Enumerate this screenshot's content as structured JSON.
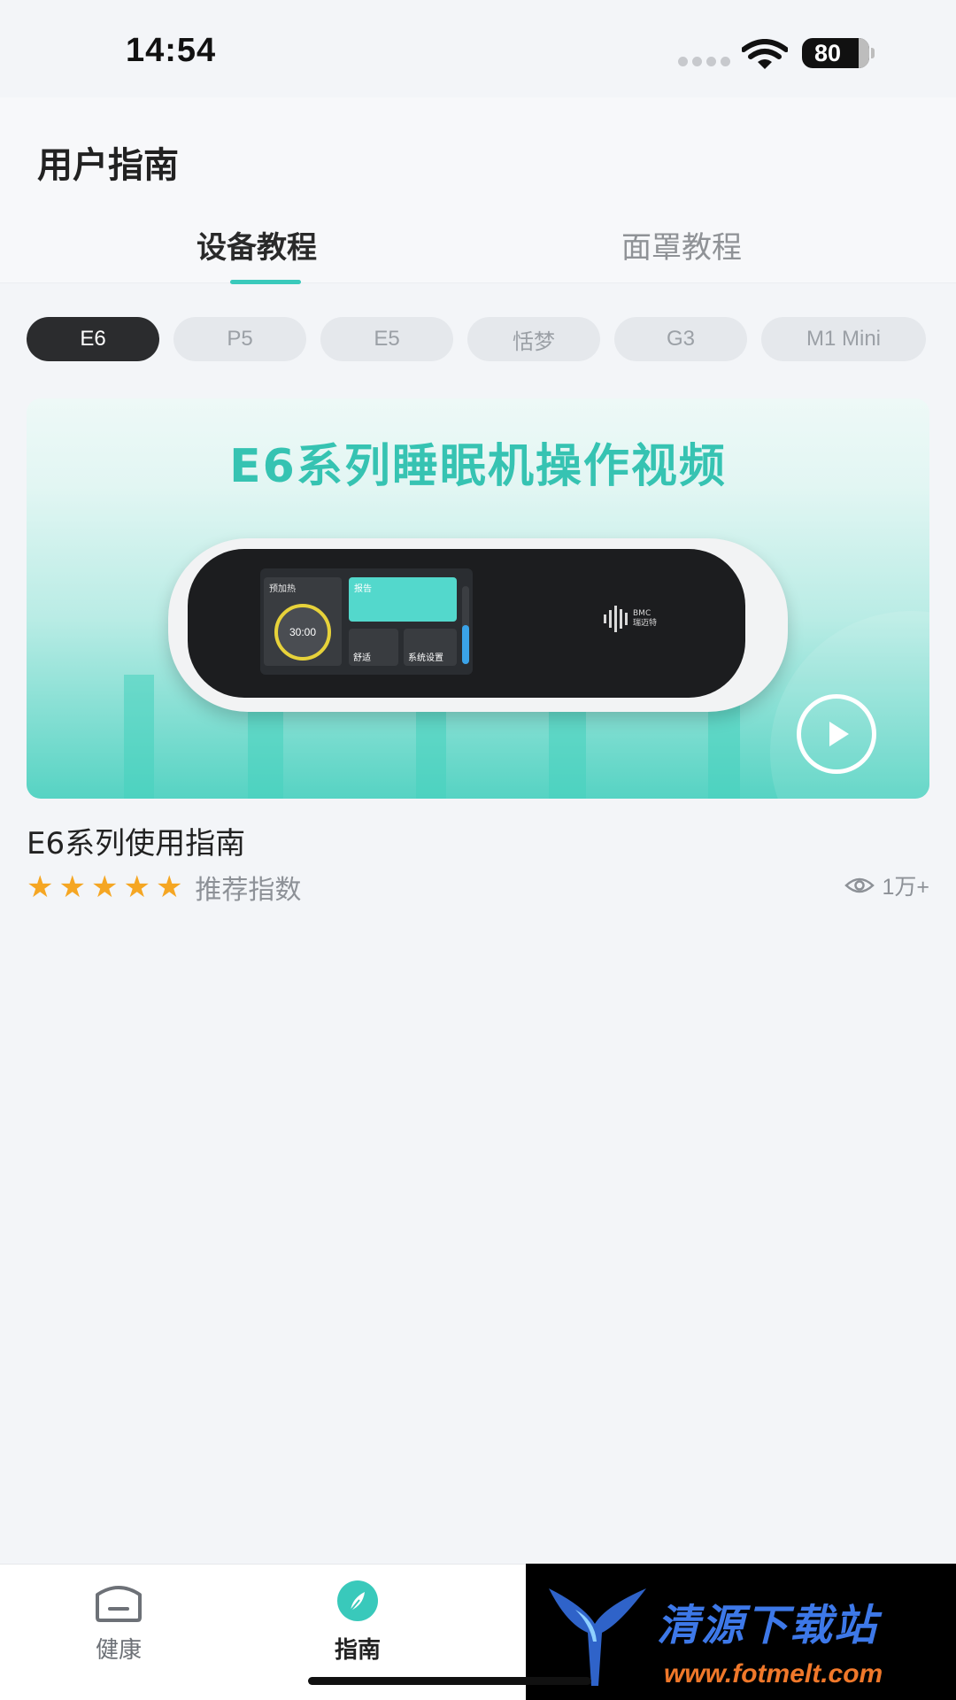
{
  "status_bar": {
    "time": "14:54",
    "battery": "80"
  },
  "header": {
    "title": "用户指南",
    "tabs": [
      {
        "label": "设备教程",
        "active": true
      },
      {
        "label": "面罩教程",
        "active": false
      }
    ]
  },
  "device_filters": {
    "items": [
      {
        "label": "E6",
        "selected": true
      },
      {
        "label": "P5",
        "selected": false
      },
      {
        "label": "E5",
        "selected": false
      },
      {
        "label": "恬梦",
        "selected": false
      },
      {
        "label": "G3",
        "selected": false
      },
      {
        "label": "M1 Mini",
        "selected": false
      }
    ]
  },
  "video_card": {
    "headline": "E6系列睡眠机操作视频",
    "screen": {
      "preheat_label": "预加热",
      "timer": "30:00",
      "report_label": "报告",
      "comfort_label": "舒适",
      "settings_label": "系统设置"
    },
    "logo_text": "BMC",
    "logo_subtext": "瑞迈特",
    "title": "E6系列使用指南",
    "rating": 5,
    "rating_label": "推荐指数",
    "views": "1万+"
  },
  "bottom_nav": {
    "items": [
      {
        "label": "健康",
        "icon": "home-icon",
        "active": false
      },
      {
        "label": "指南",
        "icon": "compass-icon",
        "active": true
      }
    ]
  },
  "watermark": {
    "text": "清源下载站",
    "url": "www.fotmelt.com"
  },
  "colors": {
    "accent": "#39c9bb",
    "chip_active": "#2b2c2e",
    "star": "#f5a623"
  }
}
